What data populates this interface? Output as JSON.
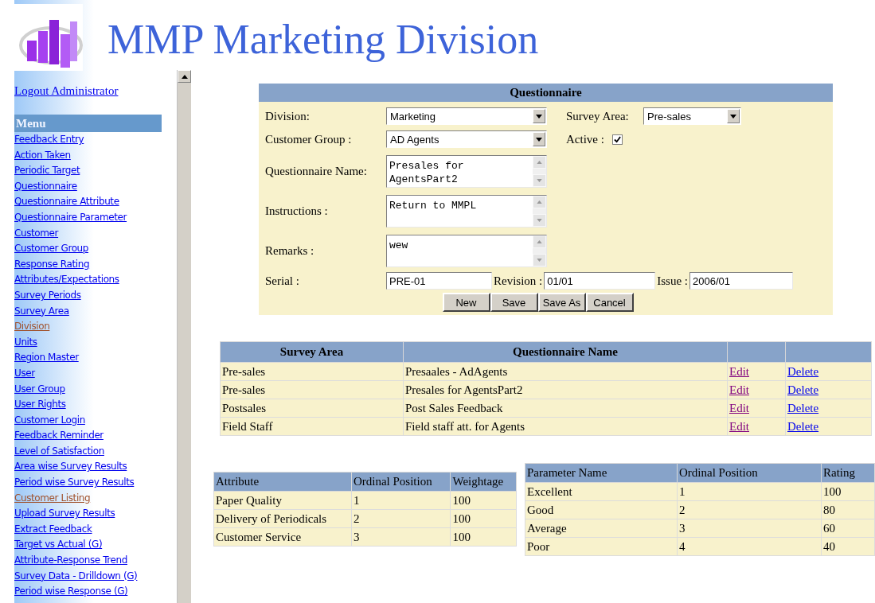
{
  "header": {
    "title": "MMP Marketing Division"
  },
  "sidebar": {
    "logout": "Logout Administrator",
    "menu_title": "Menu",
    "items": [
      {
        "label": "Feedback Entry",
        "visited": false
      },
      {
        "label": "Action Taken",
        "visited": false
      },
      {
        "label": "Periodic Target",
        "visited": false
      },
      {
        "label": "Questionnaire",
        "visited": false
      },
      {
        "label": "Questionnaire Attribute",
        "visited": false
      },
      {
        "label": "Questionnaire Parameter",
        "visited": false
      },
      {
        "label": "Customer",
        "visited": false
      },
      {
        "label": "Customer Group",
        "visited": false
      },
      {
        "label": "Response Rating",
        "visited": false
      },
      {
        "label": "Attributes/Expectations",
        "visited": false
      },
      {
        "label": "Survey Periods",
        "visited": false
      },
      {
        "label": "Survey Area",
        "visited": false
      },
      {
        "label": "Division",
        "visited": true
      },
      {
        "label": "Units",
        "visited": false
      },
      {
        "label": "Region Master",
        "visited": false
      },
      {
        "label": "User",
        "visited": false
      },
      {
        "label": "User Group",
        "visited": false
      },
      {
        "label": "User Rights",
        "visited": false
      },
      {
        "label": "Customer Login",
        "visited": false
      },
      {
        "label": "Feedback Reminder",
        "visited": false
      },
      {
        "label": "Level of Satisfaction",
        "visited": false
      },
      {
        "label": "Area wise Survey Results",
        "visited": false
      },
      {
        "label": "Period wise Survey Results",
        "visited": false
      },
      {
        "label": "Customer Listing",
        "visited": true
      },
      {
        "label": "Upload Survey Results",
        "visited": false
      },
      {
        "label": "Extract Feedback",
        "visited": false
      },
      {
        "label": "Target vs Actual (G)",
        "visited": false
      },
      {
        "label": "Attribute-Response Trend",
        "visited": false
      },
      {
        "label": "Survey Data - Drilldown (G)",
        "visited": false
      },
      {
        "label": "Period wise Response (G)",
        "visited": false
      }
    ]
  },
  "form": {
    "title": "Questionnaire",
    "division": {
      "label": "Division:",
      "value": "Marketing"
    },
    "survey_area": {
      "label": "Survey Area:",
      "value": "Pre-sales"
    },
    "customer_group": {
      "label": "Customer Group :",
      "value": "AD Agents"
    },
    "active": {
      "label": "Active :",
      "checked": true
    },
    "questionnaire_name": {
      "label": "Questionnaire Name:",
      "value": "Presales for AgentsPart2"
    },
    "instructions": {
      "label": "Instructions :",
      "value": "Return to MMPL"
    },
    "remarks": {
      "label": "Remarks :",
      "value": "wew"
    },
    "serial": {
      "label": "Serial :",
      "value": "PRE-01"
    },
    "revision": {
      "label": "Revision :",
      "value": "01/01"
    },
    "issue": {
      "label": "Issue :",
      "value": "2006/01"
    },
    "buttons": [
      "New",
      "Save",
      "Save As",
      "Cancel"
    ]
  },
  "survey_table": {
    "columns": [
      "Survey Area",
      "Questionnaire Name"
    ],
    "rows": [
      {
        "survey_area": "Pre-sales",
        "questionnaire_name": "Presaales - AdAgents",
        "edit": {
          "label": "Edit",
          "visited": true
        },
        "delete": {
          "label": "Delete",
          "visited": false
        }
      },
      {
        "survey_area": "Pre-sales",
        "questionnaire_name": "Presales for AgentsPart2",
        "edit": {
          "label": "Edit",
          "visited": true
        },
        "delete": {
          "label": "Delete",
          "visited": false
        }
      },
      {
        "survey_area": "Postsales",
        "questionnaire_name": "Post Sales Feedback",
        "edit": {
          "label": "Edit",
          "visited": true
        },
        "delete": {
          "label": "Delete",
          "visited": false
        }
      },
      {
        "survey_area": "Field Staff",
        "questionnaire_name": "Field staff att. for Agents",
        "edit": {
          "label": "Edit",
          "visited": true
        },
        "delete": {
          "label": "Delete",
          "visited": false
        }
      }
    ]
  },
  "attribute_table": {
    "columns": [
      "Attribute",
      "Ordinal Position",
      "Weightage"
    ],
    "rows": [
      [
        "Paper Quality",
        "1",
        "100"
      ],
      [
        "Delivery of Periodicals",
        "2",
        "100"
      ],
      [
        "Customer Service",
        "3",
        "100"
      ]
    ]
  },
  "parameter_table": {
    "columns": [
      "Parameter Name",
      "Ordinal Position",
      "Rating"
    ],
    "rows": [
      [
        "Excellent",
        "1",
        "100"
      ],
      [
        "Good",
        "2",
        "80"
      ],
      [
        "Average",
        "3",
        "60"
      ],
      [
        "Poor",
        "4",
        "40"
      ]
    ]
  }
}
